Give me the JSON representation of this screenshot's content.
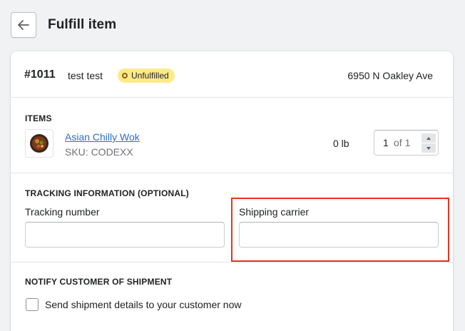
{
  "header": {
    "title": "Fulfill item",
    "back_icon": "arrow-left-icon"
  },
  "order": {
    "number": "#1011",
    "customer": "test test",
    "status": "Unfulfilled",
    "status_color": "#ffea8a",
    "address": "6950 N Oakley Ave"
  },
  "items": {
    "label": "ITEMS",
    "product": {
      "name": "Asian Chilly Wok",
      "sku": "SKU: CODEXX",
      "weight": "0 lb",
      "quantity": "1",
      "quantity_of": "of 1",
      "link_color": "#2c6ecb"
    }
  },
  "tracking": {
    "label": "TRACKING INFORMATION (OPTIONAL)",
    "tracking_number_label": "Tracking number",
    "tracking_number_value": "",
    "shipping_carrier_label": "Shipping carrier",
    "shipping_carrier_value": "",
    "highlight_color": "#e8321f"
  },
  "notify": {
    "label": "NOTIFY CUSTOMER OF SHIPMENT",
    "checkbox_label": "Send shipment details to your customer now",
    "checked": false
  }
}
